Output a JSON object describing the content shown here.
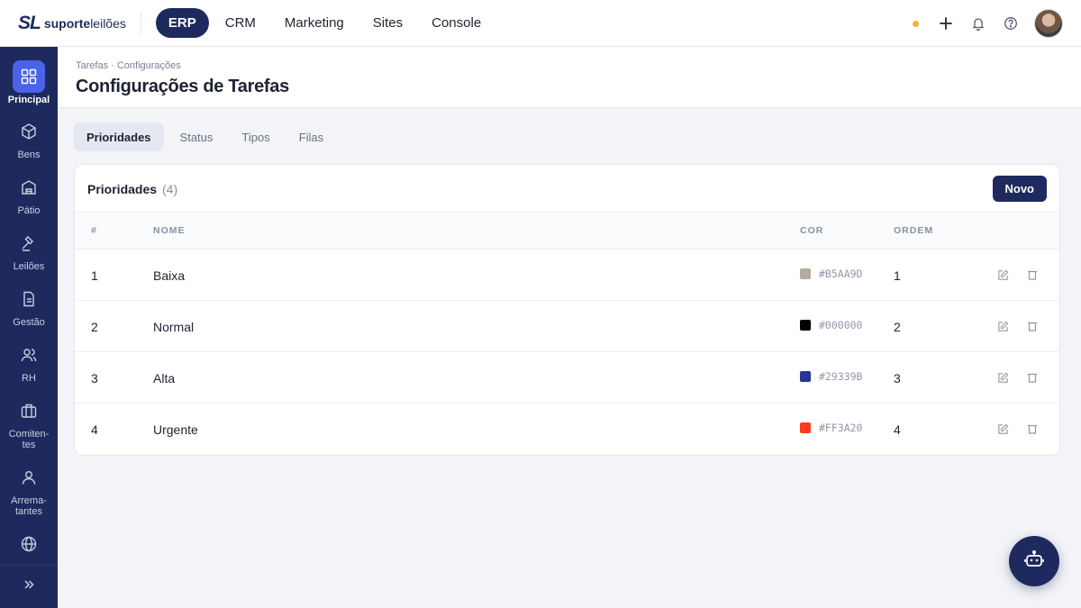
{
  "brand": {
    "mark": "SL",
    "name_bold": "suporte",
    "name_light": "leilões"
  },
  "topnav": [
    "ERP",
    "CRM",
    "Marketing",
    "Sites",
    "Console"
  ],
  "topnav_active": "ERP",
  "sidebar": {
    "items": [
      {
        "label": "Principal",
        "icon": "grid-icon",
        "active": true
      },
      {
        "label": "Bens",
        "icon": "cube-icon"
      },
      {
        "label": "Pátio",
        "icon": "warehouse-icon"
      },
      {
        "label": "Leilões",
        "icon": "gavel-icon"
      },
      {
        "label": "Gestão",
        "icon": "document-icon"
      },
      {
        "label": "RH",
        "icon": "users-icon"
      },
      {
        "label": "Comiten-\ntes",
        "icon": "briefcase-icon"
      },
      {
        "label": "Arrema-\ntantes",
        "icon": "user-icon"
      },
      {
        "label": "",
        "icon": "globe-icon"
      }
    ],
    "collapse_icon": "chevrons-right-icon"
  },
  "header": {
    "breadcrumb": "Tarefas · Configurações",
    "title": "Configurações de Tarefas"
  },
  "tabs": [
    "Prioridades",
    "Status",
    "Tipos",
    "Filas"
  ],
  "active_tab": "Prioridades",
  "card": {
    "title": "Prioridades",
    "count": "(4)",
    "new_button": "Novo"
  },
  "table": {
    "columns": [
      "#",
      "NOME",
      "COR",
      "ORDEM"
    ],
    "rows": [
      {
        "id": "1",
        "name": "Baixa",
        "color": "#B5AA9D",
        "order": "1"
      },
      {
        "id": "2",
        "name": "Normal",
        "color": "#000000",
        "order": "2"
      },
      {
        "id": "3",
        "name": "Alta",
        "color": "#29339B",
        "order": "3"
      },
      {
        "id": "4",
        "name": "Urgente",
        "color": "#FF3A20",
        "order": "4"
      }
    ]
  },
  "colors": {
    "primary": "#1e2a5e",
    "accent": "#4a63e8",
    "status_dot": "#f3b23a"
  }
}
